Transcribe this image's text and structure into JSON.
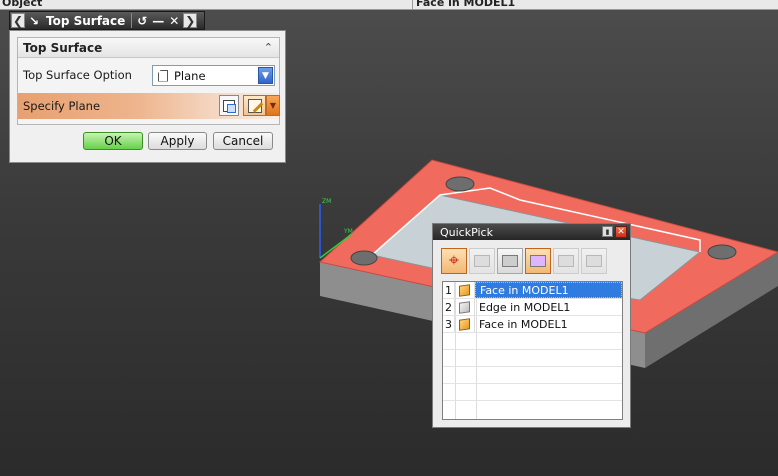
{
  "topbar": {
    "left_text": "Object",
    "right_text": "Face in MODEL1"
  },
  "dialog": {
    "title": "Top Surface",
    "group_title": "Top Surface",
    "option_label": "Top Surface Option",
    "option_value": "Plane",
    "specify_label": "Specify Plane",
    "ok_label": "OK",
    "apply_label": "Apply",
    "cancel_label": "Cancel"
  },
  "axes": {
    "z_label": "ZM",
    "y_label": "YM"
  },
  "quickpick": {
    "title": "QuickPick",
    "items": [
      {
        "index": "1",
        "label": "Face in MODEL1",
        "selected": true,
        "icon": "solid-cube-icon"
      },
      {
        "index": "2",
        "label": "Edge in MODEL1",
        "selected": false,
        "icon": "edge-cube-icon"
      },
      {
        "index": "3",
        "label": "Face in MODEL1",
        "selected": false,
        "icon": "solid-cube-icon"
      }
    ]
  },
  "colors": {
    "highlight": "#f06b5e",
    "selection": "#2f7be0",
    "ok_green": "#66d14a",
    "accent_orange": "#e7a071"
  }
}
